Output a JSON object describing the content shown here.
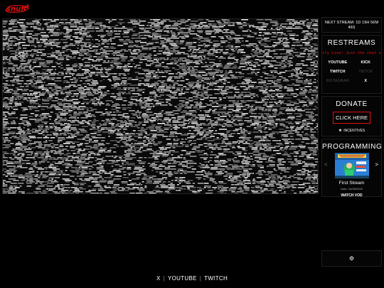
{
  "brand": {
    "logo_text": "snuff",
    "accent": "#e01010"
  },
  "next_stream": {
    "text": "NEXT STREAM: 1D 19H 56M 46S"
  },
  "restreams": {
    "title": "RESTREAMS",
    "ticker": "ify Live! Join the chat on",
    "links": [
      {
        "label": "YOUTUBE",
        "enabled": true
      },
      {
        "label": "KICK",
        "enabled": true
      },
      {
        "label": "TWITCH",
        "enabled": true
      },
      {
        "label": "TIKTOK",
        "enabled": false
      },
      {
        "label": "INSTAGRAM",
        "enabled": false
      },
      {
        "label": "X",
        "enabled": true
      }
    ]
  },
  "donate": {
    "title": "DONATE",
    "button_label": "CLICK HERE",
    "incentives_label": "INCENTIVES"
  },
  "programming": {
    "title": "PROGRAMMING",
    "prev_icon": "chevron-left-icon",
    "next_icon": "chevron-right-icon",
    "item": {
      "title": "First Stream",
      "date": "Date: 10/08/2025",
      "watch_label": "WATCH VOD"
    }
  },
  "settings": {
    "icon": "gear-icon"
  },
  "footer": {
    "links": [
      "X",
      "YOUTUBE",
      "TWITCH"
    ]
  }
}
